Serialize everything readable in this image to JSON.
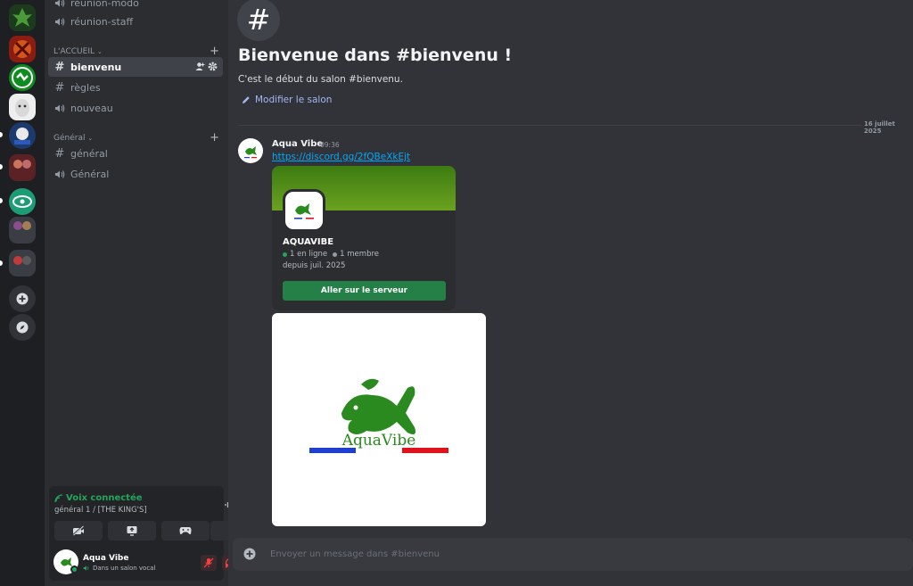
{
  "channels": {
    "top_items": [
      {
        "label": "réunion-modo",
        "type": "voice"
      },
      {
        "label": "réunion-staff",
        "type": "voice"
      }
    ],
    "categories": [
      {
        "name": "L'ACCUEIL",
        "items": [
          {
            "label": "bienvenu",
            "type": "text",
            "active": true
          },
          {
            "label": "règles",
            "type": "text"
          },
          {
            "label": "nouveau",
            "type": "voice"
          }
        ]
      },
      {
        "name": "Général",
        "items": [
          {
            "label": "général",
            "type": "text"
          },
          {
            "label": "Général",
            "type": "voice"
          }
        ]
      }
    ]
  },
  "voice_panel": {
    "title": "Voix connectée",
    "subtitle": "général 1 / [THE KING'S]"
  },
  "user": {
    "name": "Aqua Vibe",
    "status": "Dans un salon vocal"
  },
  "header": {
    "welcome": "Bienvenue dans #bienvenu !",
    "subtitle": "C'est le début du salon #bienvenu.",
    "edit_link": "Modifier le salon",
    "date": "16 juillet 2025"
  },
  "message": {
    "author": "Aqua Vibe",
    "time": "09:36",
    "link": "https://discord.gg/2fQBeXkEjt"
  },
  "invite": {
    "server_name": "AQUAVIBE",
    "online": "1 en ligne",
    "members": "1 membre",
    "since": "depuis juil. 2025",
    "button": "Aller sur le serveur"
  },
  "image": {
    "brand": "AquaVibe"
  },
  "composer": {
    "placeholder": "Envoyer un message dans #bienvenu"
  },
  "colors": {
    "accent_green": "#23a55a",
    "button_green": "#248046",
    "link_blue": "#00a8fc",
    "brand_green": "#2a8a1f",
    "flag_blue": "#1e3fd0",
    "flag_red": "#e0121b"
  }
}
